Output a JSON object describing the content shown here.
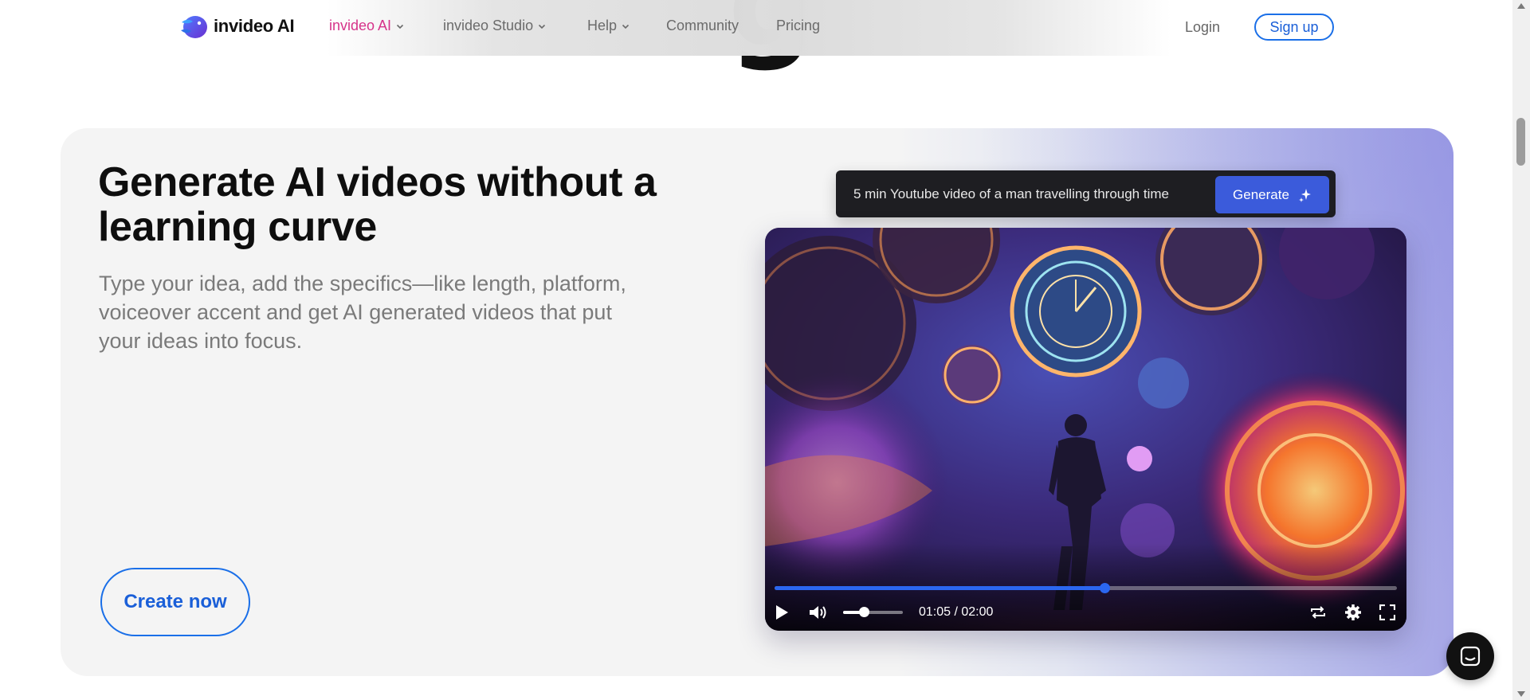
{
  "nav": {
    "brand": "invideo AI",
    "items": [
      {
        "label": "invideo AI",
        "dropdown": true,
        "active": true
      },
      {
        "label": "invideo Studio",
        "dropdown": true,
        "active": false
      },
      {
        "label": "Help",
        "dropdown": true,
        "active": false
      },
      {
        "label": "Community",
        "dropdown": false,
        "active": false
      },
      {
        "label": "Pricing",
        "dropdown": false,
        "active": false
      }
    ],
    "login": "Login",
    "signup": "Sign up"
  },
  "hero": {
    "headline": "Generate AI videos without a learning curve",
    "subtext": "Type your idea, add the specifics—like length, platform, voiceover accent and get AI generated videos that put your ideas into focus.",
    "cta": "Create now"
  },
  "prompt": {
    "text": "5 min Youtube video of a man travelling through time",
    "button": "Generate"
  },
  "player": {
    "time": "01:05 / 02:00",
    "progress": 0.53,
    "volume": 0.35
  },
  "colors": {
    "accent_pink": "#d6338a",
    "accent_blue": "#1a6fe8",
    "generate_bg": "#3b5bdb",
    "progress_blue": "#2b67f0"
  }
}
